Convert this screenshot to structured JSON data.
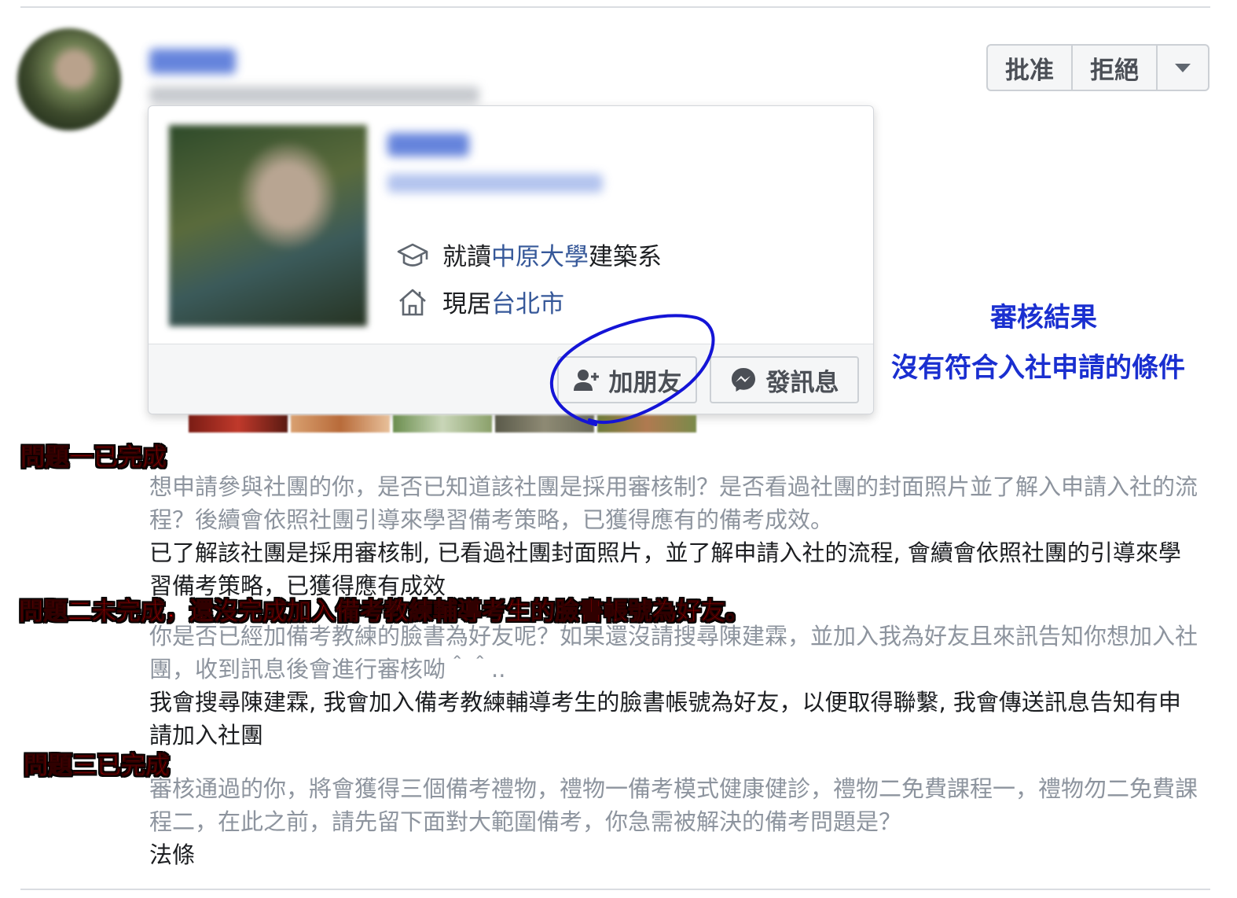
{
  "request_actions": {
    "approve": "批准",
    "decline": "拒絕"
  },
  "profile_card": {
    "education_prefix": "就讀",
    "school": "中原大學",
    "department": "建築系",
    "lives_prefix": "現居",
    "city": "台北市",
    "add_friend": "加朋友",
    "message": "發訊息"
  },
  "review": {
    "title": "審核結果",
    "result": "沒有符合入社申請的條件"
  },
  "annotations": {
    "q1_status": "問題一已完成",
    "q2_status": "問題二未完成，還沒完成加入備考教練輔導考生的臉書帳號為好友。",
    "q3_status": "問題三已完成"
  },
  "questions": [
    {
      "question": "想申請參與社團的你，是否已知道該社團是採用審核制？是否看過社團的封面照片並了解入申請入社的流程？後續會依照社團引導來學習備考策略，已獲得應有的備考成效。",
      "answer": "已了解該社團是採用審核制, 已看過社團封面照片，並了解申請入社的流程, 會續會依照社團的引導來學習備考策略，已獲得應有成效"
    },
    {
      "question": "你是否已經加備考教練的臉書為好友呢？如果還沒請搜尋陳建霖，並加入我為好友且來訊告知你想加入社團，收到訊息後會進行審核呦＾＾..",
      "answer": "我會搜尋陳建霖, 我會加入備考教練輔導考生的臉書帳號為好友，以便取得聯繫, 我會傳送訊息告知有申請加入社團"
    },
    {
      "question": "審核通過的你，將會獲得三個備考禮物，禮物一備考模式健康健診，禮物二免費課程一，禮物勿二免費課程二，在此之前，請先留下面對大範圍備考，你急需被解決的備考問題是？",
      "answer": "法條"
    }
  ],
  "colors": {
    "link_blue": "#365899",
    "annotation_blue": "#1a2fd0",
    "annotation_red": "#e10000",
    "question_gray": "#8d949e"
  }
}
